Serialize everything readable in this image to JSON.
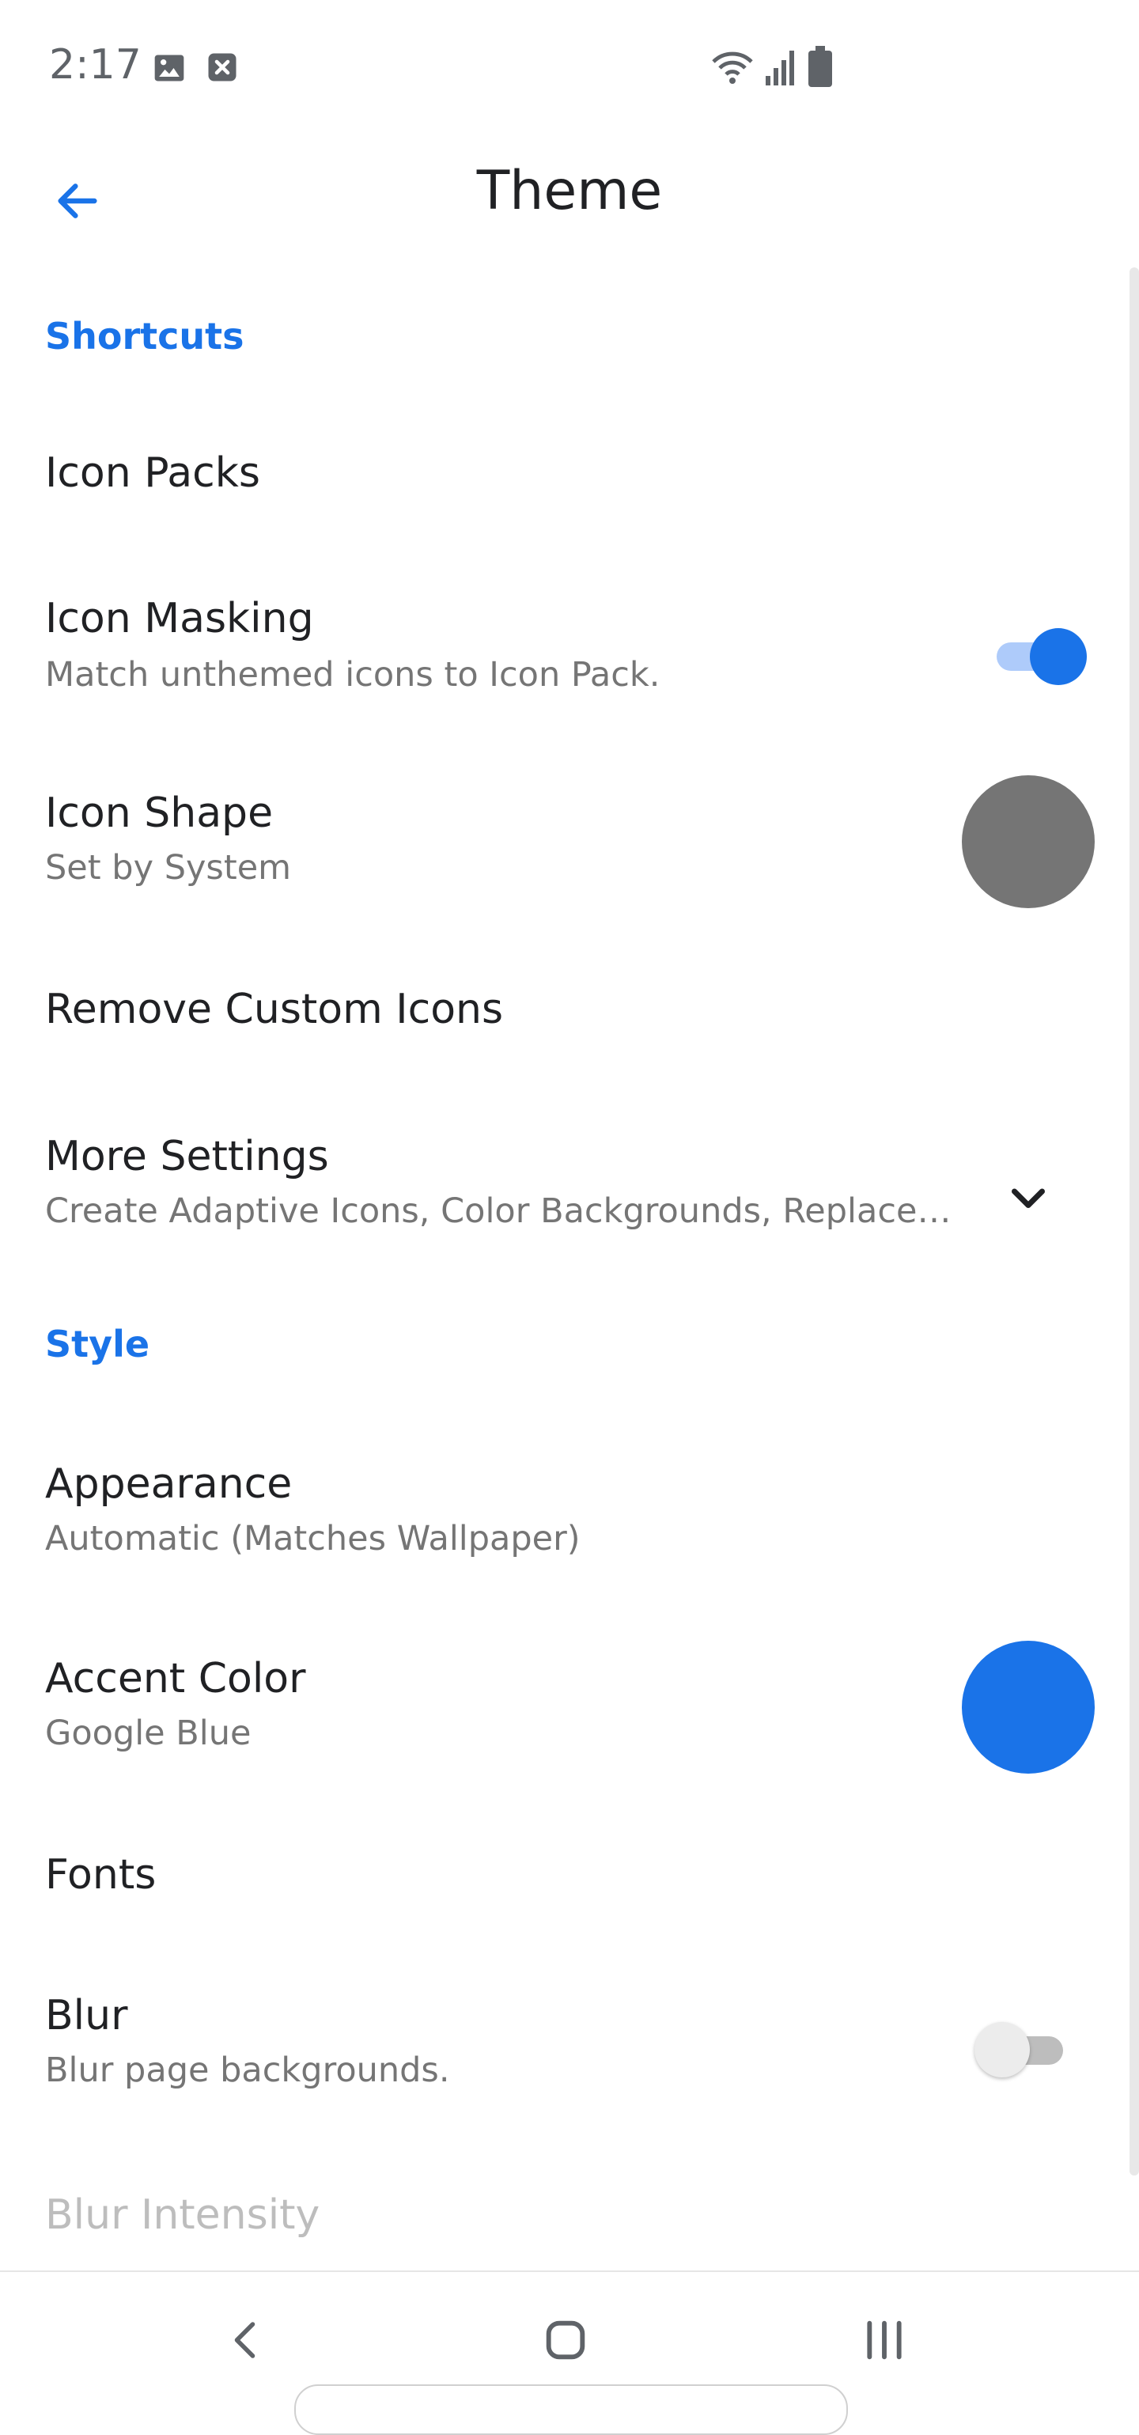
{
  "status_bar": {
    "time": "2:17",
    "icons": [
      "image-icon",
      "close-box-icon",
      "wifi-icon",
      "signal-icon",
      "battery-icon"
    ]
  },
  "app_bar": {
    "title": "Theme",
    "back_icon": "arrow-left-icon"
  },
  "colors": {
    "accent": "#1a73e8",
    "icon_shape_gray": "#757575"
  },
  "sections": {
    "shortcuts": "Shortcuts",
    "style": "Style"
  },
  "rows": {
    "icon_packs": {
      "title": "Icon Packs"
    },
    "icon_masking": {
      "title": "Icon Masking",
      "subtitle": "Match unthemed icons to Icon Pack.",
      "enabled": true
    },
    "icon_shape": {
      "title": "Icon Shape",
      "subtitle": "Set by System"
    },
    "remove_custom_icons": {
      "title": "Remove Custom Icons"
    },
    "more_settings": {
      "title": "More Settings",
      "subtitle": "Create Adaptive Icons, Color Backgrounds, Replace…"
    },
    "appearance": {
      "title": "Appearance",
      "subtitle": "Automatic (Matches Wallpaper)"
    },
    "accent_color": {
      "title": "Accent Color",
      "subtitle": "Google Blue"
    },
    "fonts": {
      "title": "Fonts"
    },
    "blur": {
      "title": "Blur",
      "subtitle": "Blur page backgrounds.",
      "enabled": false
    },
    "blur_intensity": {
      "title": "Blur Intensity"
    }
  },
  "nav_bar": {
    "icons": [
      "nav-back-icon",
      "nav-home-icon",
      "nav-recents-icon"
    ]
  }
}
